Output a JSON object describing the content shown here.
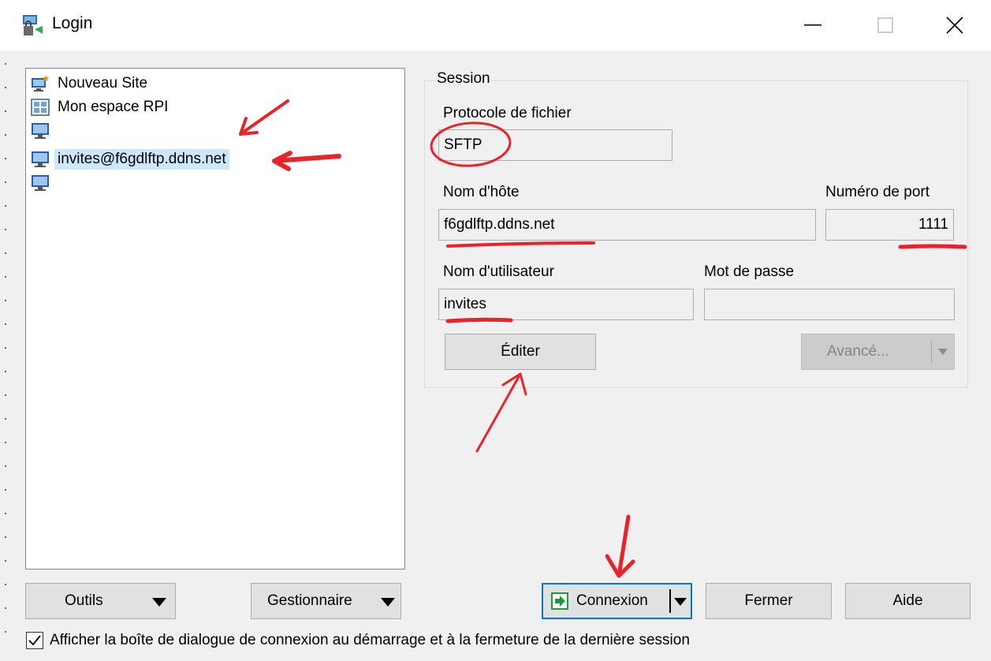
{
  "window": {
    "title": "Login"
  },
  "sites": [
    {
      "label": "Nouveau Site",
      "icon": "new-site-icon"
    },
    {
      "label": "Mon espace  RPI",
      "icon": "site-grid-icon"
    },
    {
      "label": "",
      "icon": "monitor-icon"
    },
    {
      "label": "invites@f6gdlftp.ddns.net",
      "icon": "monitor-icon",
      "selected": true
    },
    {
      "label": "",
      "icon": "monitor-icon"
    }
  ],
  "session": {
    "legend": "Session",
    "protocol_label": "Protocole de fichier",
    "protocol_value": "SFTP",
    "host_label": "Nom d'hôte",
    "host_value": "f6gdlftp.ddns.net",
    "port_label": "Numéro de port",
    "port_value": "1111",
    "user_label": "Nom d'utilisateur",
    "user_value": "invites",
    "password_label": "Mot de passe",
    "password_value": "",
    "edit_button": "Éditer",
    "advanced_button": "Avancé..."
  },
  "buttons": {
    "tools": "Outils",
    "manager": "Gestionnaire",
    "connect": "Connexion",
    "close": "Fermer",
    "help": "Aide"
  },
  "show_dialog_checkbox": {
    "label": "Afficher la boîte de dialogue de connexion au démarrage et à la fermeture de la dernière session",
    "checked": true
  },
  "colors": {
    "annotation": "#e8232b",
    "selection": "#cce8ff",
    "focus_border": "#0078d7",
    "connect_icon": "#1a9b3a"
  }
}
